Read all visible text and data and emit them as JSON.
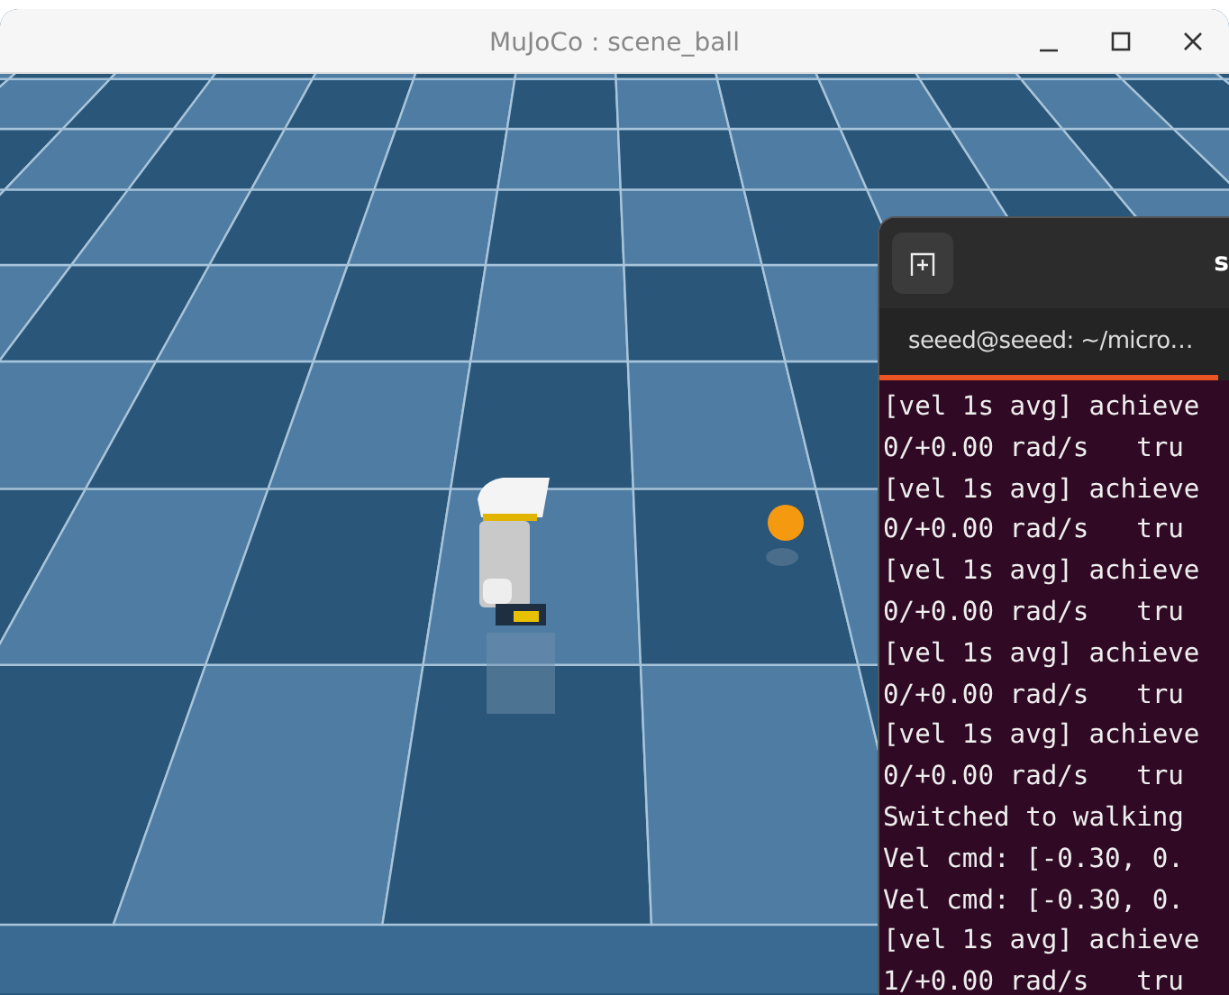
{
  "window": {
    "title": "MuJoCo : scene_ball"
  },
  "terminal": {
    "title": "s",
    "tab": {
      "label": "seeed@seeed: ~/micro…",
      "selected": true
    },
    "lines": [
      "[vel 1s avg] achieve",
      "0/+0.00 rad/s   tru",
      "[vel 1s avg] achieve",
      "0/+0.00 rad/s   tru",
      "[vel 1s avg] achieve",
      "0/+0.00 rad/s   tru",
      "[vel 1s avg] achieve",
      "0/+0.00 rad/s   tru",
      "[vel 1s avg] achieve",
      "0/+0.00 rad/s   tru",
      "Switched to walking",
      "Vel cmd: [-0.30, 0.",
      "Vel cmd: [-0.30, 0.",
      "[vel 1s avg] achieve",
      "1/+0.00 rad/s   tru"
    ]
  }
}
